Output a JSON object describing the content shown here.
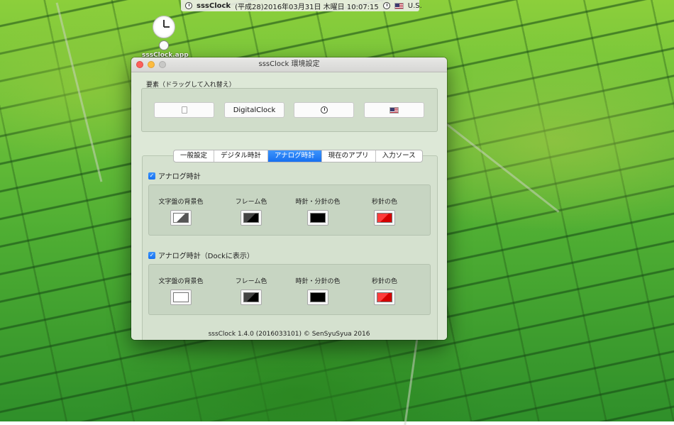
{
  "menubar": {
    "app_name": "sssClock",
    "datetime": "(平成28)2016年03月31日 木曜日 10:07:15",
    "input_source": "U.S."
  },
  "desktop": {
    "icon_label": "sssClock.app"
  },
  "window": {
    "title": "sssClock 環境設定",
    "elements_label": "要素（ドラッグして入れ替え）",
    "elements": [
      "",
      "DigitalClock",
      "",
      ""
    ],
    "tabs": [
      {
        "label": "一般設定",
        "active": false
      },
      {
        "label": "デジタル時計",
        "active": false
      },
      {
        "label": "アナログ時計",
        "active": true
      },
      {
        "label": "現在のアプリ",
        "active": false
      },
      {
        "label": "入力ソース",
        "active": false
      }
    ],
    "section1": {
      "checkbox_label": "アナログ時計",
      "checked": true,
      "colors": [
        {
          "label": "文字盤の背景色",
          "swatch": "gray-white"
        },
        {
          "label": "フレーム色",
          "swatch": "dark-gray"
        },
        {
          "label": "時針・分針の色",
          "swatch": "#000000"
        },
        {
          "label": "秒針の色",
          "swatch": "#e8141c"
        }
      ]
    },
    "section2": {
      "checkbox_label": "アナログ時計（Dockに表示）",
      "checked": true,
      "colors": [
        {
          "label": "文字盤の背景色",
          "swatch": "#ffffff"
        },
        {
          "label": "フレーム色",
          "swatch": "dark-gray"
        },
        {
          "label": "時針・分針の色",
          "swatch": "#000000"
        },
        {
          "label": "秒針の色",
          "swatch": "#e8141c"
        }
      ]
    },
    "footer": "sssClock 1.4.0 (2016033101) © SenSyuSyua 2016"
  },
  "colors": {
    "accent": "#1670f0",
    "close": "#fc605c",
    "minimize": "#fdbc40"
  }
}
